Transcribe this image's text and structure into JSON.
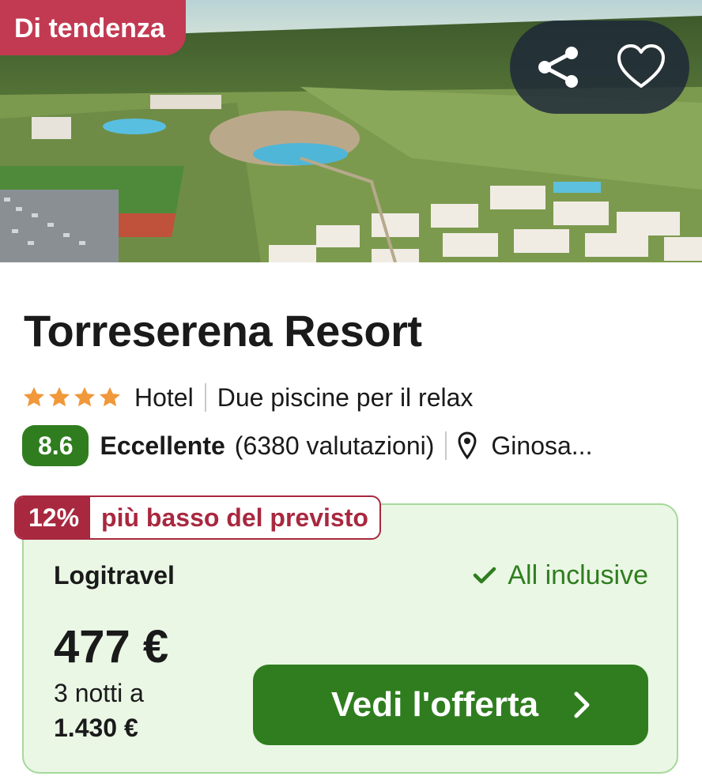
{
  "hero": {
    "badge": "Di tendenza",
    "share_icon": "share-icon",
    "favorite_icon": "heart-icon"
  },
  "hotel": {
    "name": "Torreserena Resort",
    "stars": 4,
    "type": "Hotel",
    "tagline": "Due piscine per il relax",
    "score": "8.6",
    "rating_word": "Eccellente",
    "reviews": "(6380 valutazioni)",
    "location": "Ginosa..."
  },
  "offer": {
    "discount_pct": "12%",
    "discount_text": "più basso del previsto",
    "provider": "Logitravel",
    "board": "All inclusive",
    "price": "477 €",
    "nights_label": "3 notti a",
    "total_price": "1.430 €",
    "cta_label": "Vedi l'offerta"
  },
  "colors": {
    "accent_red": "#c23a52",
    "badge_red": "#a8283f",
    "green": "#2f7d1f",
    "offer_bg": "#eaf7e5",
    "star": "#f0983a"
  }
}
